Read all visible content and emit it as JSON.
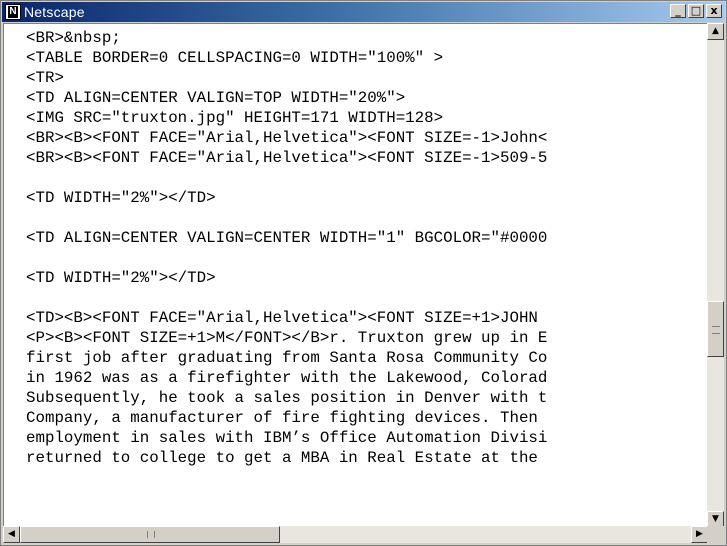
{
  "window": {
    "title": "Netscape",
    "controls": {
      "minimize_glyph": "_",
      "maximize_glyph": "□",
      "close_glyph": "x"
    }
  },
  "source_lines": [
    "<BR>&nbsp;",
    "<TABLE BORDER=0 CELLSPACING=0 WIDTH=\"100%\" >",
    "<TR>",
    "<TD ALIGN=CENTER VALIGN=TOP WIDTH=\"20%\">",
    "<IMG SRC=\"truxton.jpg\" HEIGHT=171 WIDTH=128>",
    "<BR><B><FONT FACE=\"Arial,Helvetica\"><FONT SIZE=-1>John<",
    "<BR><B><FONT FACE=\"Arial,Helvetica\"><FONT SIZE=-1>509-5",
    "",
    "<TD WIDTH=\"2%\"></TD>",
    "",
    "<TD ALIGN=CENTER VALIGN=CENTER WIDTH=\"1\" BGCOLOR=\"#0000",
    "",
    "<TD WIDTH=\"2%\"></TD>",
    "",
    "<TD><B><FONT FACE=\"Arial,Helvetica\"><FONT SIZE=+1>JOHN",
    "<P><B><FONT SIZE=+1>M</FONT></B>r. Truxton grew up in E",
    "first job after graduating from Santa Rosa Community Co",
    "in 1962 was as a firefighter with the Lakewood, Colorad",
    "Subsequently, he took a sales position in Denver with t",
    "Company, a manufacturer of fire fighting devices. Then",
    "employment in sales with IBM’s Office Automation Divisi",
    "returned to college to get a MBA in Real Estate at the"
  ],
  "scrollbars": {
    "up_glyph": "▲",
    "down_glyph": "▼",
    "left_glyph": "◀",
    "right_glyph": "▶"
  }
}
